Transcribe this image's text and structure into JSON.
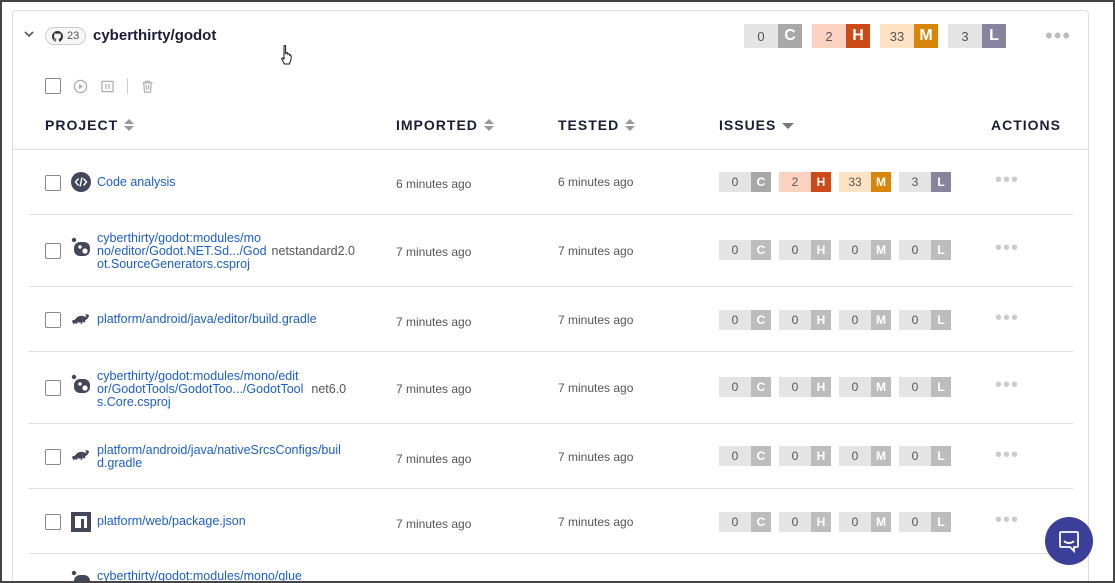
{
  "group": {
    "count": "23",
    "name": "cyberthirty/godot",
    "issues": {
      "c": "0",
      "h": "2",
      "m": "33",
      "l": "3"
    }
  },
  "columns": {
    "project": "PROJECT",
    "imported": "IMPORTED",
    "tested": "TESTED",
    "issues": "ISSUES",
    "actions": "ACTIONS"
  },
  "severity_letters": {
    "c": "C",
    "h": "H",
    "m": "M",
    "l": "L"
  },
  "colors": {
    "critical": "#a8a8a8",
    "high": "#cb4a18",
    "medium": "#d8860b",
    "low": "#88849e",
    "link": "#1c5fc7",
    "chat": "#3b3f97"
  },
  "rows": [
    {
      "icon": "code-icon",
      "name": "Code analysis",
      "tf": "",
      "imported": "6 minutes ago",
      "tested": "6 minutes ago",
      "issues": {
        "c": "0",
        "h": "2",
        "m": "33",
        "l": "3"
      }
    },
    {
      "icon": "nuget-icon",
      "name": "cyberthirty/godot:modules/mono/editor/Godot.NET.Sd.../Godot.SourceGenerators.csproj",
      "line1": "cyberthirty/godot:modules/mo",
      "line2": "no/editor/Godot.NET.Sd.../God",
      "line3": "ot.SourceGenerators.csproj",
      "tf": "netstandard2.0",
      "imported": "7 minutes ago",
      "tested": "7 minutes ago",
      "issues": {
        "c": "0",
        "h": "0",
        "m": "0",
        "l": "0"
      }
    },
    {
      "icon": "gradle-icon",
      "name": "platform/android/java/editor/build.gradle",
      "tf": "",
      "imported": "7 minutes ago",
      "tested": "7 minutes ago",
      "issues": {
        "c": "0",
        "h": "0",
        "m": "0",
        "l": "0"
      }
    },
    {
      "icon": "nuget-icon",
      "name": "cyberthirty/godot:modules/mono/editor/GodotTools/GodotToo.../GodotTools.Core.csproj",
      "line1": "cyberthirty/godot:modules/mono/edit",
      "line2": "or/GodotTools/GodotToo.../GodotTool",
      "line3": "s.Core.csproj",
      "tf": "net6.0",
      "imported": "7 minutes ago",
      "tested": "7 minutes ago",
      "issues": {
        "c": "0",
        "h": "0",
        "m": "0",
        "l": "0"
      }
    },
    {
      "icon": "gradle-icon",
      "name": "platform/android/java/nativeSrcsConfigs/build.gradle",
      "line1": "platform/android/java/nativeSrcsConfigs/buil",
      "line2": "d.gradle",
      "tf": "",
      "imported": "7 minutes ago",
      "tested": "7 minutes ago",
      "issues": {
        "c": "0",
        "h": "0",
        "m": "0",
        "l": "0"
      }
    },
    {
      "icon": "npm-icon",
      "name": "platform/web/package.json",
      "tf": "",
      "imported": "7 minutes ago",
      "tested": "7 minutes ago",
      "issues": {
        "c": "0",
        "h": "0",
        "m": "0",
        "l": "0"
      }
    },
    {
      "icon": "nuget-icon",
      "name": "cyberthirty/godot:modules/mono/glue",
      "tf": "",
      "imported": "",
      "tested": "",
      "issues": null
    }
  ]
}
